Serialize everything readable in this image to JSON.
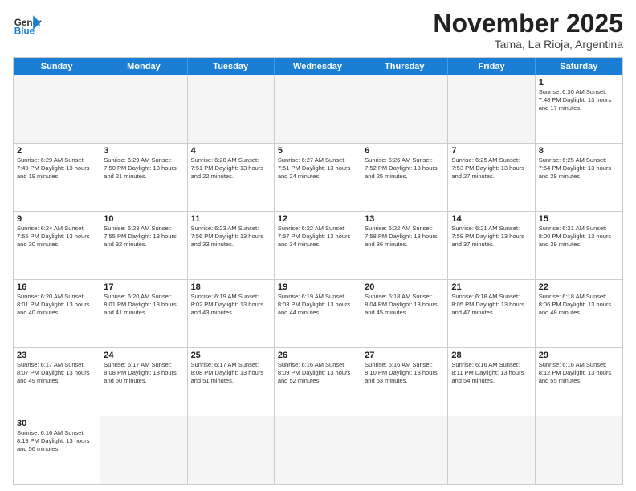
{
  "header": {
    "logo_general": "General",
    "logo_blue": "Blue",
    "month_title": "November 2025",
    "subtitle": "Tama, La Rioja, Argentina"
  },
  "day_headers": [
    "Sunday",
    "Monday",
    "Tuesday",
    "Wednesday",
    "Thursday",
    "Friday",
    "Saturday"
  ],
  "weeks": [
    [
      {
        "day": "",
        "info": ""
      },
      {
        "day": "",
        "info": ""
      },
      {
        "day": "",
        "info": ""
      },
      {
        "day": "",
        "info": ""
      },
      {
        "day": "",
        "info": ""
      },
      {
        "day": "",
        "info": ""
      },
      {
        "day": "1",
        "info": "Sunrise: 6:30 AM\nSunset: 7:48 PM\nDaylight: 13 hours and 17 minutes."
      }
    ],
    [
      {
        "day": "2",
        "info": "Sunrise: 6:29 AM\nSunset: 7:49 PM\nDaylight: 13 hours and 19 minutes."
      },
      {
        "day": "3",
        "info": "Sunrise: 6:29 AM\nSunset: 7:50 PM\nDaylight: 13 hours and 21 minutes."
      },
      {
        "day": "4",
        "info": "Sunrise: 6:28 AM\nSunset: 7:51 PM\nDaylight: 13 hours and 22 minutes."
      },
      {
        "day": "5",
        "info": "Sunrise: 6:27 AM\nSunset: 7:51 PM\nDaylight: 13 hours and 24 minutes."
      },
      {
        "day": "6",
        "info": "Sunrise: 6:26 AM\nSunset: 7:52 PM\nDaylight: 13 hours and 25 minutes."
      },
      {
        "day": "7",
        "info": "Sunrise: 6:25 AM\nSunset: 7:53 PM\nDaylight: 13 hours and 27 minutes."
      },
      {
        "day": "8",
        "info": "Sunrise: 6:25 AM\nSunset: 7:54 PM\nDaylight: 13 hours and 29 minutes."
      }
    ],
    [
      {
        "day": "9",
        "info": "Sunrise: 6:24 AM\nSunset: 7:55 PM\nDaylight: 13 hours and 30 minutes."
      },
      {
        "day": "10",
        "info": "Sunrise: 6:23 AM\nSunset: 7:55 PM\nDaylight: 13 hours and 32 minutes."
      },
      {
        "day": "11",
        "info": "Sunrise: 6:23 AM\nSunset: 7:56 PM\nDaylight: 13 hours and 33 minutes."
      },
      {
        "day": "12",
        "info": "Sunrise: 6:22 AM\nSunset: 7:57 PM\nDaylight: 13 hours and 34 minutes."
      },
      {
        "day": "13",
        "info": "Sunrise: 6:22 AM\nSunset: 7:58 PM\nDaylight: 13 hours and 36 minutes."
      },
      {
        "day": "14",
        "info": "Sunrise: 6:21 AM\nSunset: 7:59 PM\nDaylight: 13 hours and 37 minutes."
      },
      {
        "day": "15",
        "info": "Sunrise: 6:21 AM\nSunset: 8:00 PM\nDaylight: 13 hours and 39 minutes."
      }
    ],
    [
      {
        "day": "16",
        "info": "Sunrise: 6:20 AM\nSunset: 8:01 PM\nDaylight: 13 hours and 40 minutes."
      },
      {
        "day": "17",
        "info": "Sunrise: 6:20 AM\nSunset: 8:01 PM\nDaylight: 13 hours and 41 minutes."
      },
      {
        "day": "18",
        "info": "Sunrise: 6:19 AM\nSunset: 8:02 PM\nDaylight: 13 hours and 43 minutes."
      },
      {
        "day": "19",
        "info": "Sunrise: 6:19 AM\nSunset: 8:03 PM\nDaylight: 13 hours and 44 minutes."
      },
      {
        "day": "20",
        "info": "Sunrise: 6:18 AM\nSunset: 8:04 PM\nDaylight: 13 hours and 45 minutes."
      },
      {
        "day": "21",
        "info": "Sunrise: 6:18 AM\nSunset: 8:05 PM\nDaylight: 13 hours and 47 minutes."
      },
      {
        "day": "22",
        "info": "Sunrise: 6:18 AM\nSunset: 8:06 PM\nDaylight: 13 hours and 48 minutes."
      }
    ],
    [
      {
        "day": "23",
        "info": "Sunrise: 6:17 AM\nSunset: 8:07 PM\nDaylight: 13 hours and 49 minutes."
      },
      {
        "day": "24",
        "info": "Sunrise: 6:17 AM\nSunset: 8:08 PM\nDaylight: 13 hours and 50 minutes."
      },
      {
        "day": "25",
        "info": "Sunrise: 6:17 AM\nSunset: 8:08 PM\nDaylight: 13 hours and 51 minutes."
      },
      {
        "day": "26",
        "info": "Sunrise: 6:16 AM\nSunset: 8:09 PM\nDaylight: 13 hours and 52 minutes."
      },
      {
        "day": "27",
        "info": "Sunrise: 6:16 AM\nSunset: 8:10 PM\nDaylight: 13 hours and 53 minutes."
      },
      {
        "day": "28",
        "info": "Sunrise: 6:16 AM\nSunset: 8:11 PM\nDaylight: 13 hours and 54 minutes."
      },
      {
        "day": "29",
        "info": "Sunrise: 6:16 AM\nSunset: 8:12 PM\nDaylight: 13 hours and 55 minutes."
      }
    ],
    [
      {
        "day": "30",
        "info": "Sunrise: 6:16 AM\nSunset: 8:13 PM\nDaylight: 13 hours and 56 minutes."
      },
      {
        "day": "",
        "info": ""
      },
      {
        "day": "",
        "info": ""
      },
      {
        "day": "",
        "info": ""
      },
      {
        "day": "",
        "info": ""
      },
      {
        "day": "",
        "info": ""
      },
      {
        "day": "",
        "info": ""
      }
    ]
  ]
}
